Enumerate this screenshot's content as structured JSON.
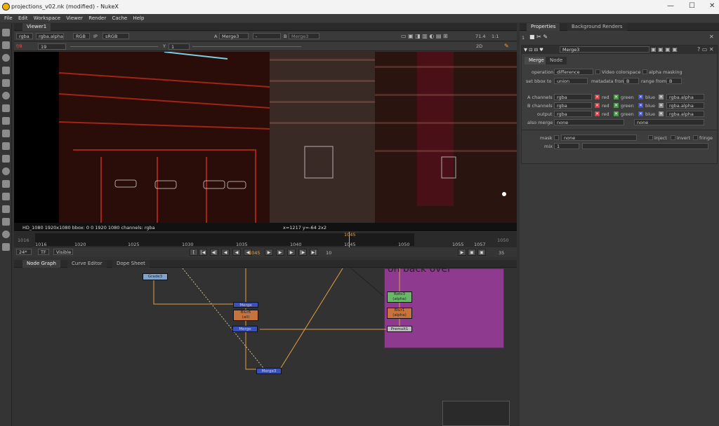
{
  "window": {
    "title": "projections_v02.nk (modified) - NukeX"
  },
  "menu": [
    "File",
    "Edit",
    "Workspace",
    "Viewer",
    "Render",
    "Cache",
    "Help"
  ],
  "viewer_panel": {
    "tab": "Viewer1",
    "toolbar": {
      "channels": "rgba",
      "alpha": "rgba.alpha",
      "colorspace_mode": "RGB",
      "ip": "IP",
      "lut": "sRGB",
      "a_label": "A",
      "a_input": "Merge3",
      "dash": "-",
      "b_label": "B",
      "b_input": "Merge3",
      "zoom": "71.4",
      "ratio": "1:1"
    },
    "toolbar2": {
      "fstop": "f/8",
      "gain_val": "19",
      "y_label": "Y",
      "gamma_val": "1",
      "mode": "2D"
    },
    "info_left": "HD_1080 1920x1080  bbox: 0 0 1920 1080 channels: rgba",
    "info_mid": "x=1217 y=-64 2x2",
    "timeline": {
      "ticks": [
        "1016",
        "1020",
        "1025",
        "1030",
        "1035",
        "1040",
        "1045",
        "1050",
        "1055",
        "1057"
      ],
      "range_start": "1016",
      "range_end": "1050",
      "current": "1045"
    },
    "playback": {
      "fps": "24*",
      "tf": "TF",
      "visible": "Visible",
      "frame": "1045",
      "inc": "10",
      "end": "35"
    }
  },
  "node_graph": {
    "tabs": [
      "Node Graph",
      "Curve Editor",
      "Dope Sheet"
    ],
    "backdrop_label": "on back over",
    "nodes": [
      {
        "id": "grade",
        "label": "Grade3",
        "color": "#7fa3c9"
      },
      {
        "id": "merge_a",
        "label": "Merge",
        "color": "#3a52b8"
      },
      {
        "id": "blur6",
        "label": "Blur6\n(all)",
        "color": "#c7733e"
      },
      {
        "id": "merge_b",
        "label": "Merge",
        "color": "#3a52b8"
      },
      {
        "id": "merge_c",
        "label": "Merge3",
        "color": "#3a52b8"
      },
      {
        "id": "roto3",
        "label": "Roto3\n(alpha)",
        "color": "#69b86a"
      },
      {
        "id": "blur1",
        "label": "Blur1\n(alpha)",
        "color": "#c7733e"
      },
      {
        "id": "premult",
        "label": "Premult1",
        "color": "#bdbdbd"
      }
    ]
  },
  "properties": {
    "tabs": [
      "Properties",
      "Background Renders"
    ],
    "count": "1",
    "node_name": "Merge3",
    "subtabs": [
      "Merge",
      "Node"
    ],
    "operation_label": "operation",
    "operation": "difference",
    "video_colorspace": "Video colorspace",
    "alpha_masking": "alpha masking",
    "set_bbox_label": "set bbox to",
    "set_bbox": "union",
    "metadata_from_label": "metadata from",
    "metadata_from": "B",
    "range_from_label": "range from",
    "range_from": "B",
    "rows": [
      {
        "label": "A channels",
        "value": "rgba",
        "alpha": "rgba.alpha"
      },
      {
        "label": "B channels",
        "value": "rgba",
        "alpha": "rgba.alpha"
      },
      {
        "label": "output",
        "value": "rgba",
        "alpha": "rgba.alpha"
      }
    ],
    "chan_names": [
      "red",
      "green",
      "blue"
    ],
    "also_merge_label": "also merge",
    "also_merge": "none",
    "also_merge2": "none",
    "mask_label": "mask",
    "mask": "none",
    "inject": "inject",
    "invert": "invert",
    "fringe": "fringe",
    "mix_label": "mix",
    "mix": "1",
    "mix_ticks": [
      "0",
      "0.1",
      "0.2",
      "0.3",
      "0.4",
      "0.5",
      "0.6",
      "0.7",
      "0.8",
      "0.9",
      "1"
    ]
  },
  "colors": {
    "accent": "#f0a030",
    "backdrop": "#8e3a8e",
    "selected": "#5a7bd8"
  }
}
